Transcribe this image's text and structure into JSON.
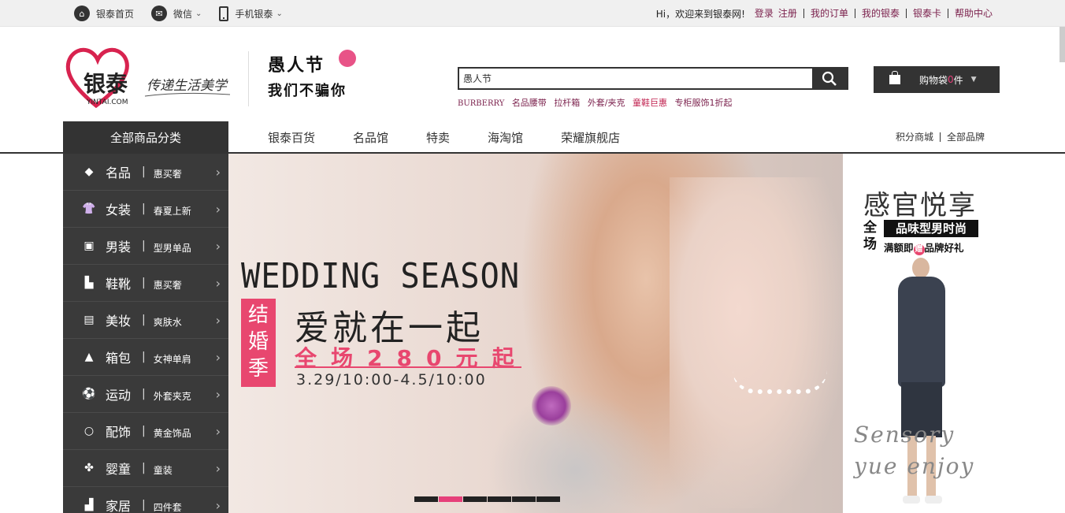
{
  "topbar": {
    "home": "银泰首页",
    "wechat": "微信",
    "mobile": "手机银泰",
    "welcome": "Hi，欢迎来到银泰网!",
    "login": "登录",
    "register": "注册",
    "links": [
      "我的订单",
      "我的银泰",
      "银泰卡",
      "帮助中心"
    ]
  },
  "logo": {
    "brand": "银泰",
    "domain": "YINTAI.COM",
    "slogan": "传递生活美学"
  },
  "promo": {
    "line1": "愚人节",
    "line2": "我们不骗你"
  },
  "search": {
    "value": "愚人节"
  },
  "hotwords": [
    "BURBERRY",
    "名品腰带",
    "拉杆箱",
    "外套/夹克",
    "童鞋巨惠",
    "专柜服饰1折起"
  ],
  "cart": {
    "label_pre": "购物袋",
    "count": "0",
    "label_post": "件"
  },
  "nav": {
    "category_title": "全部商品分类",
    "items": [
      "银泰百货",
      "名品馆",
      "特卖",
      "海淘馆",
      "荣耀旗舰店"
    ],
    "right": [
      "积分商城",
      "全部品牌"
    ]
  },
  "categories": [
    {
      "name": "名品",
      "sub": "惠买奢",
      "icon": "diamond-icon"
    },
    {
      "name": "女装",
      "sub": "春夏上新",
      "icon": "dress-icon"
    },
    {
      "name": "男装",
      "sub": "型男单品",
      "icon": "suit-icon"
    },
    {
      "name": "鞋靴",
      "sub": "惠买奢",
      "icon": "boot-icon"
    },
    {
      "name": "美妆",
      "sub": "爽肤水",
      "icon": "cosmetic-icon"
    },
    {
      "name": "箱包",
      "sub": "女神单肩",
      "icon": "bag-icon"
    },
    {
      "name": "运动",
      "sub": "外套夹克",
      "icon": "ball-icon"
    },
    {
      "name": "配饰",
      "sub": "黄金饰品",
      "icon": "ring-icon"
    },
    {
      "name": "婴童",
      "sub": "童装",
      "icon": "baby-icon"
    },
    {
      "name": "家居",
      "sub": "四件套",
      "icon": "sofa-icon"
    }
  ],
  "banner": {
    "title": "WEDDING SEASON",
    "tag": "结婚季",
    "headline": "爱就在一起",
    "sub": "全场280元起",
    "date": "3.29/10:00-4.5/10:00",
    "active_slide": 2,
    "slide_count": 6
  },
  "side_ad": {
    "title": "感官悦享",
    "big": "全场",
    "box": "品味型男时尚",
    "sub_pre": "满额即",
    "sub_gift": "赠",
    "sub_post": "品牌好礼",
    "script1": "Sensory",
    "script2": "yue enjoy"
  },
  "colors": {
    "accent": "#e6407a",
    "dark": "#333333",
    "link": "#7a1f4b"
  }
}
